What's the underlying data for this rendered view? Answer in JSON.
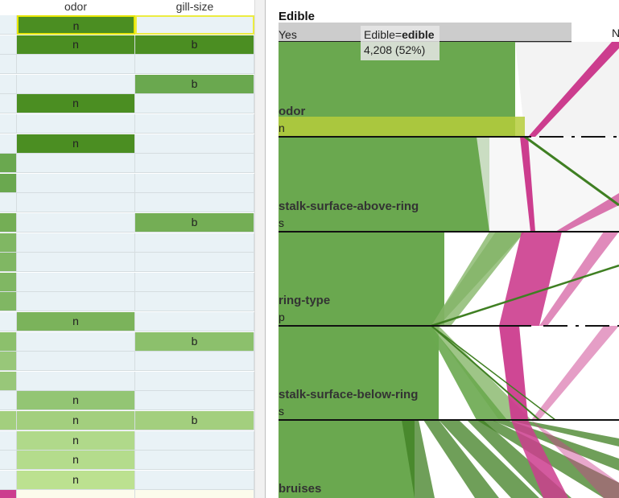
{
  "table": {
    "columns": [
      "odor",
      "gill-size"
    ],
    "rows": [
      {
        "first_color": "#e9f2f6",
        "odor": "n",
        "odor_color": "#4b8e22",
        "gill": "",
        "gill_color": "#e9f2f6",
        "selected": true
      },
      {
        "first_color": "#e9f2f6",
        "odor": "n",
        "odor_color": "#4b8e22",
        "gill": "b",
        "gill_color": "#4b8e22"
      },
      {
        "first_color": "#e9f2f6",
        "odor": "",
        "odor_color": "#e9f2f6",
        "gill": "",
        "gill_color": "#e9f2f6"
      },
      {
        "first_color": "#e9f2f6",
        "odor": "",
        "odor_color": "#e9f2f6",
        "gill": "b",
        "gill_color": "#6aa84f"
      },
      {
        "first_color": "#e9f2f6",
        "odor": "n",
        "odor_color": "#4b8e22",
        "gill": "",
        "gill_color": "#e9f2f6"
      },
      {
        "first_color": "#e9f2f6",
        "odor": "",
        "odor_color": "#e9f2f6",
        "gill": "",
        "gill_color": "#e9f2f6"
      },
      {
        "first_color": "#e9f2f6",
        "odor": "n",
        "odor_color": "#4b8e22",
        "gill": "",
        "gill_color": "#e9f2f6"
      },
      {
        "first_color": "#6aa84f",
        "odor": "",
        "odor_color": "#e9f2f6",
        "gill": "",
        "gill_color": "#e9f2f6"
      },
      {
        "first_color": "#6aa84f",
        "odor": "",
        "odor_color": "#e9f2f6",
        "gill": "",
        "gill_color": "#e9f2f6"
      },
      {
        "first_color": "#e9f2f6",
        "odor": "",
        "odor_color": "#e9f2f6",
        "gill": "",
        "gill_color": "#e9f2f6"
      },
      {
        "first_color": "#74ae55",
        "odor": "",
        "odor_color": "#e9f2f6",
        "gill": "b",
        "gill_color": "#74ae55"
      },
      {
        "first_color": "#80b763",
        "odor": "",
        "odor_color": "#e9f2f6",
        "gill": "",
        "gill_color": "#e9f2f6"
      },
      {
        "first_color": "#80b763",
        "odor": "",
        "odor_color": "#e9f2f6",
        "gill": "",
        "gill_color": "#e9f2f6"
      },
      {
        "first_color": "#80b763",
        "odor": "",
        "odor_color": "#e9f2f6",
        "gill": "",
        "gill_color": "#e9f2f6"
      },
      {
        "first_color": "#80b763",
        "odor": "",
        "odor_color": "#e9f2f6",
        "gill": "",
        "gill_color": "#e9f2f6"
      },
      {
        "first_color": "#e9f2f6",
        "odor": "n",
        "odor_color": "#7bb35b",
        "gill": "",
        "gill_color": "#e9f2f6"
      },
      {
        "first_color": "#8cc06c",
        "odor": "",
        "odor_color": "#e9f2f6",
        "gill": "b",
        "gill_color": "#8cc06c"
      },
      {
        "first_color": "#98c779",
        "odor": "",
        "odor_color": "#e9f2f6",
        "gill": "",
        "gill_color": "#e9f2f6"
      },
      {
        "first_color": "#98c779",
        "odor": "",
        "odor_color": "#e9f2f6",
        "gill": "",
        "gill_color": "#e9f2f6"
      },
      {
        "first_color": "#e9f2f6",
        "odor": "n",
        "odor_color": "#93c574",
        "gill": "",
        "gill_color": "#e9f2f6"
      },
      {
        "first_color": "#a3cf7e",
        "odor": "n",
        "odor_color": "#a3cf7e",
        "gill": "b",
        "gill_color": "#a3cf7e"
      },
      {
        "first_color": "#e9f2f6",
        "odor": "n",
        "odor_color": "#b0d98a",
        "gill": "",
        "gill_color": "#e9f2f6"
      },
      {
        "first_color": "#e9f2f6",
        "odor": "n",
        "odor_color": "#b4dc8c",
        "gill": "",
        "gill_color": "#e9f2f6"
      },
      {
        "first_color": "#e9f2f6",
        "odor": "n",
        "odor_color": "#bce190",
        "gill": "",
        "gill_color": "#e9f2f6"
      },
      {
        "first_color": "#cc3d8e",
        "odor": "",
        "odor_color": "#fcfbec",
        "gill": "",
        "gill_color": "#fcfbec"
      }
    ]
  },
  "parallel_sets": {
    "title": "Edible",
    "first_category": "Yes",
    "second_category": "N",
    "tooltip": {
      "prefix": "Edible=",
      "value": "edible",
      "count": "4,208 (52%)"
    },
    "dimensions": [
      {
        "name": "odor",
        "category": "n"
      },
      {
        "name": "stalk-surface-above-ring",
        "category": "s"
      },
      {
        "name": "ring-type",
        "category": "p"
      },
      {
        "name": "stalk-surface-below-ring",
        "category": "s"
      },
      {
        "name": "bruises",
        "category": ""
      }
    ],
    "colors": {
      "edible": "#6aa84f",
      "poisonous": "#cc3d8e",
      "highlight": "#b5cc3b",
      "axis": "#cccccc"
    }
  }
}
